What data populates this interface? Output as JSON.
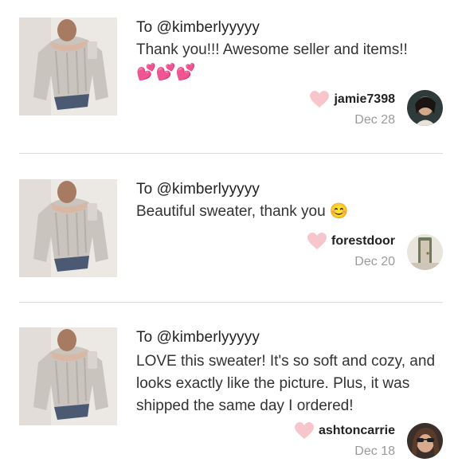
{
  "reviews": [
    {
      "to": "To @kimberlyyyyy",
      "message": "Thank you!!! Awesome seller and items!!",
      "emoji": "💕💕💕",
      "username": "jamie7398",
      "date": "Dec 28"
    },
    {
      "to": "To @kimberlyyyyy",
      "message": "Beautiful sweater, thank you 😊",
      "username": "forestdoor",
      "date": "Dec 20"
    },
    {
      "to": "To @kimberlyyyyy",
      "message": "LOVE this sweater! It's so soft and cozy, and looks exactly like the picture. Plus, it was shipped the same day I ordered!",
      "username": "ashtoncarrie",
      "date": "Dec 18"
    }
  ],
  "colors": {
    "heart": "#f7c6cc",
    "divider": "#dcdcdc",
    "date": "#9a9a9a"
  },
  "icons": {
    "like": "heart-icon"
  }
}
